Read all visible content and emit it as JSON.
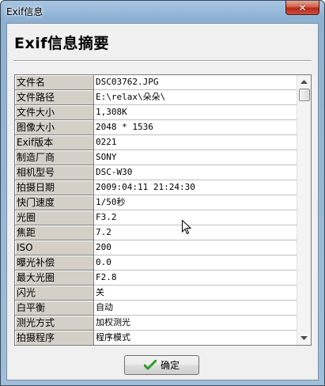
{
  "window": {
    "title": "Exif信息",
    "close_icon": "close-icon"
  },
  "dialog": {
    "heading": "Exif信息摘要",
    "ok_label": "确定"
  },
  "exif_rows": [
    {
      "key": "文件名",
      "value": "DSC03762.JPG"
    },
    {
      "key": "文件路径",
      "value": "E:\\relax\\朵朵\\"
    },
    {
      "key": "文件大小",
      "value": "1,308K"
    },
    {
      "key": "图像大小",
      "value": "2048 * 1536"
    },
    {
      "key": "Exif版本",
      "value": "0221"
    },
    {
      "key": "制造厂商",
      "value": "SONY"
    },
    {
      "key": "相机型号",
      "value": "DSC-W30"
    },
    {
      "key": "拍摄日期",
      "value": "2009:04:11 21:24:30"
    },
    {
      "key": "快门速度",
      "value": "1/50秒"
    },
    {
      "key": "光圈",
      "value": "F3.2"
    },
    {
      "key": "焦距",
      "value": "7.2"
    },
    {
      "key": "ISO",
      "value": "200"
    },
    {
      "key": "曝光补偿",
      "value": "0.0"
    },
    {
      "key": "最大光圈",
      "value": "F2.8"
    },
    {
      "key": "闪光",
      "value": "关"
    },
    {
      "key": "白平衡",
      "value": "自动"
    },
    {
      "key": "测光方式",
      "value": "加权测光"
    },
    {
      "key": "拍摄程序",
      "value": "程序模式"
    }
  ],
  "colors": {
    "ok_check": "#2e9a2e",
    "close_button": "#c8402c"
  }
}
